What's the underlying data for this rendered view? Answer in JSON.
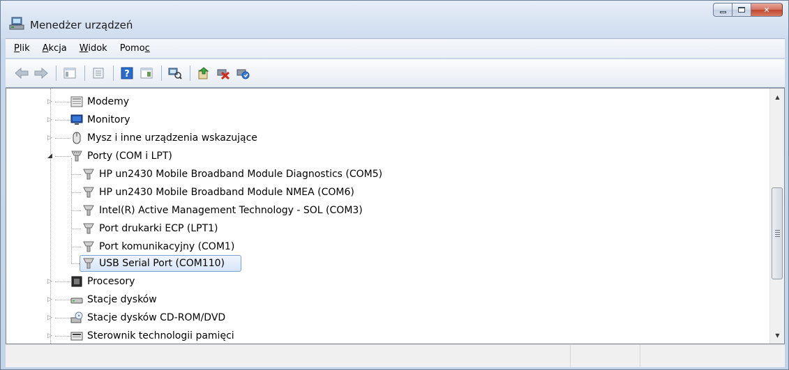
{
  "window": {
    "title": "Menedżer urządzeń"
  },
  "menu": [
    {
      "label": "Plik",
      "accel": "P",
      "rest": "lik"
    },
    {
      "label": "Akcja",
      "accel": "A",
      "rest": "kcja"
    },
    {
      "label": "Widok",
      "accel": "W",
      "rest": "idok"
    },
    {
      "label": "Pomoc",
      "pre": "Pomo",
      "accel": "c"
    }
  ],
  "toolbar": {
    "buttons": [
      "back-icon",
      "forward-icon",
      "show-hide-tree-icon",
      "properties-icon",
      "help-icon",
      "action-pane-icon",
      "scan-hardware-icon",
      "update-driver-icon",
      "disable-device-icon",
      "enable-device-icon"
    ]
  },
  "tree": {
    "items": [
      {
        "label": "Modemy",
        "icon": "modem-icon",
        "level": 1,
        "state": "collapsed"
      },
      {
        "label": "Monitory",
        "icon": "monitor-icon",
        "level": 1,
        "state": "collapsed"
      },
      {
        "label": "Mysz i inne urządzenia wskazujące",
        "icon": "mouse-icon",
        "level": 1,
        "state": "collapsed"
      },
      {
        "label": "Porty (COM i LPT)",
        "icon": "port-icon",
        "level": 1,
        "state": "expanded"
      },
      {
        "label": "HP un2430 Mobile Broadband Module Diagnostics (COM5)",
        "icon": "port-icon",
        "level": 2
      },
      {
        "label": "HP un2430 Mobile Broadband Module NMEA (COM6)",
        "icon": "port-icon",
        "level": 2
      },
      {
        "label": "Intel(R) Active Management Technology - SOL (COM3)",
        "icon": "port-icon",
        "level": 2
      },
      {
        "label": "Port drukarki ECP (LPT1)",
        "icon": "port-icon",
        "level": 2
      },
      {
        "label": "Port komunikacyjny (COM1)",
        "icon": "port-icon",
        "level": 2
      },
      {
        "label": "USB Serial Port (COM110)",
        "icon": "port-icon",
        "level": 2,
        "selected": true
      },
      {
        "label": "Procesory",
        "icon": "processor-icon",
        "level": 1,
        "state": "collapsed"
      },
      {
        "label": "Stacje dysków",
        "icon": "disk-drive-icon",
        "level": 1,
        "state": "collapsed"
      },
      {
        "label": "Stacje dysków CD-ROM/DVD",
        "icon": "cdrom-icon",
        "level": 1,
        "state": "collapsed"
      },
      {
        "label": "Sterownik technologii pamięci",
        "icon": "memory-controller-icon",
        "level": 1,
        "state": "collapsed"
      }
    ]
  },
  "colors": {
    "selection_border": "#7da2ce",
    "selection_fill": "#d6e6f8",
    "close_button": "#c2452f"
  },
  "statusbar": {
    "cells": [
      "",
      "",
      ""
    ]
  }
}
